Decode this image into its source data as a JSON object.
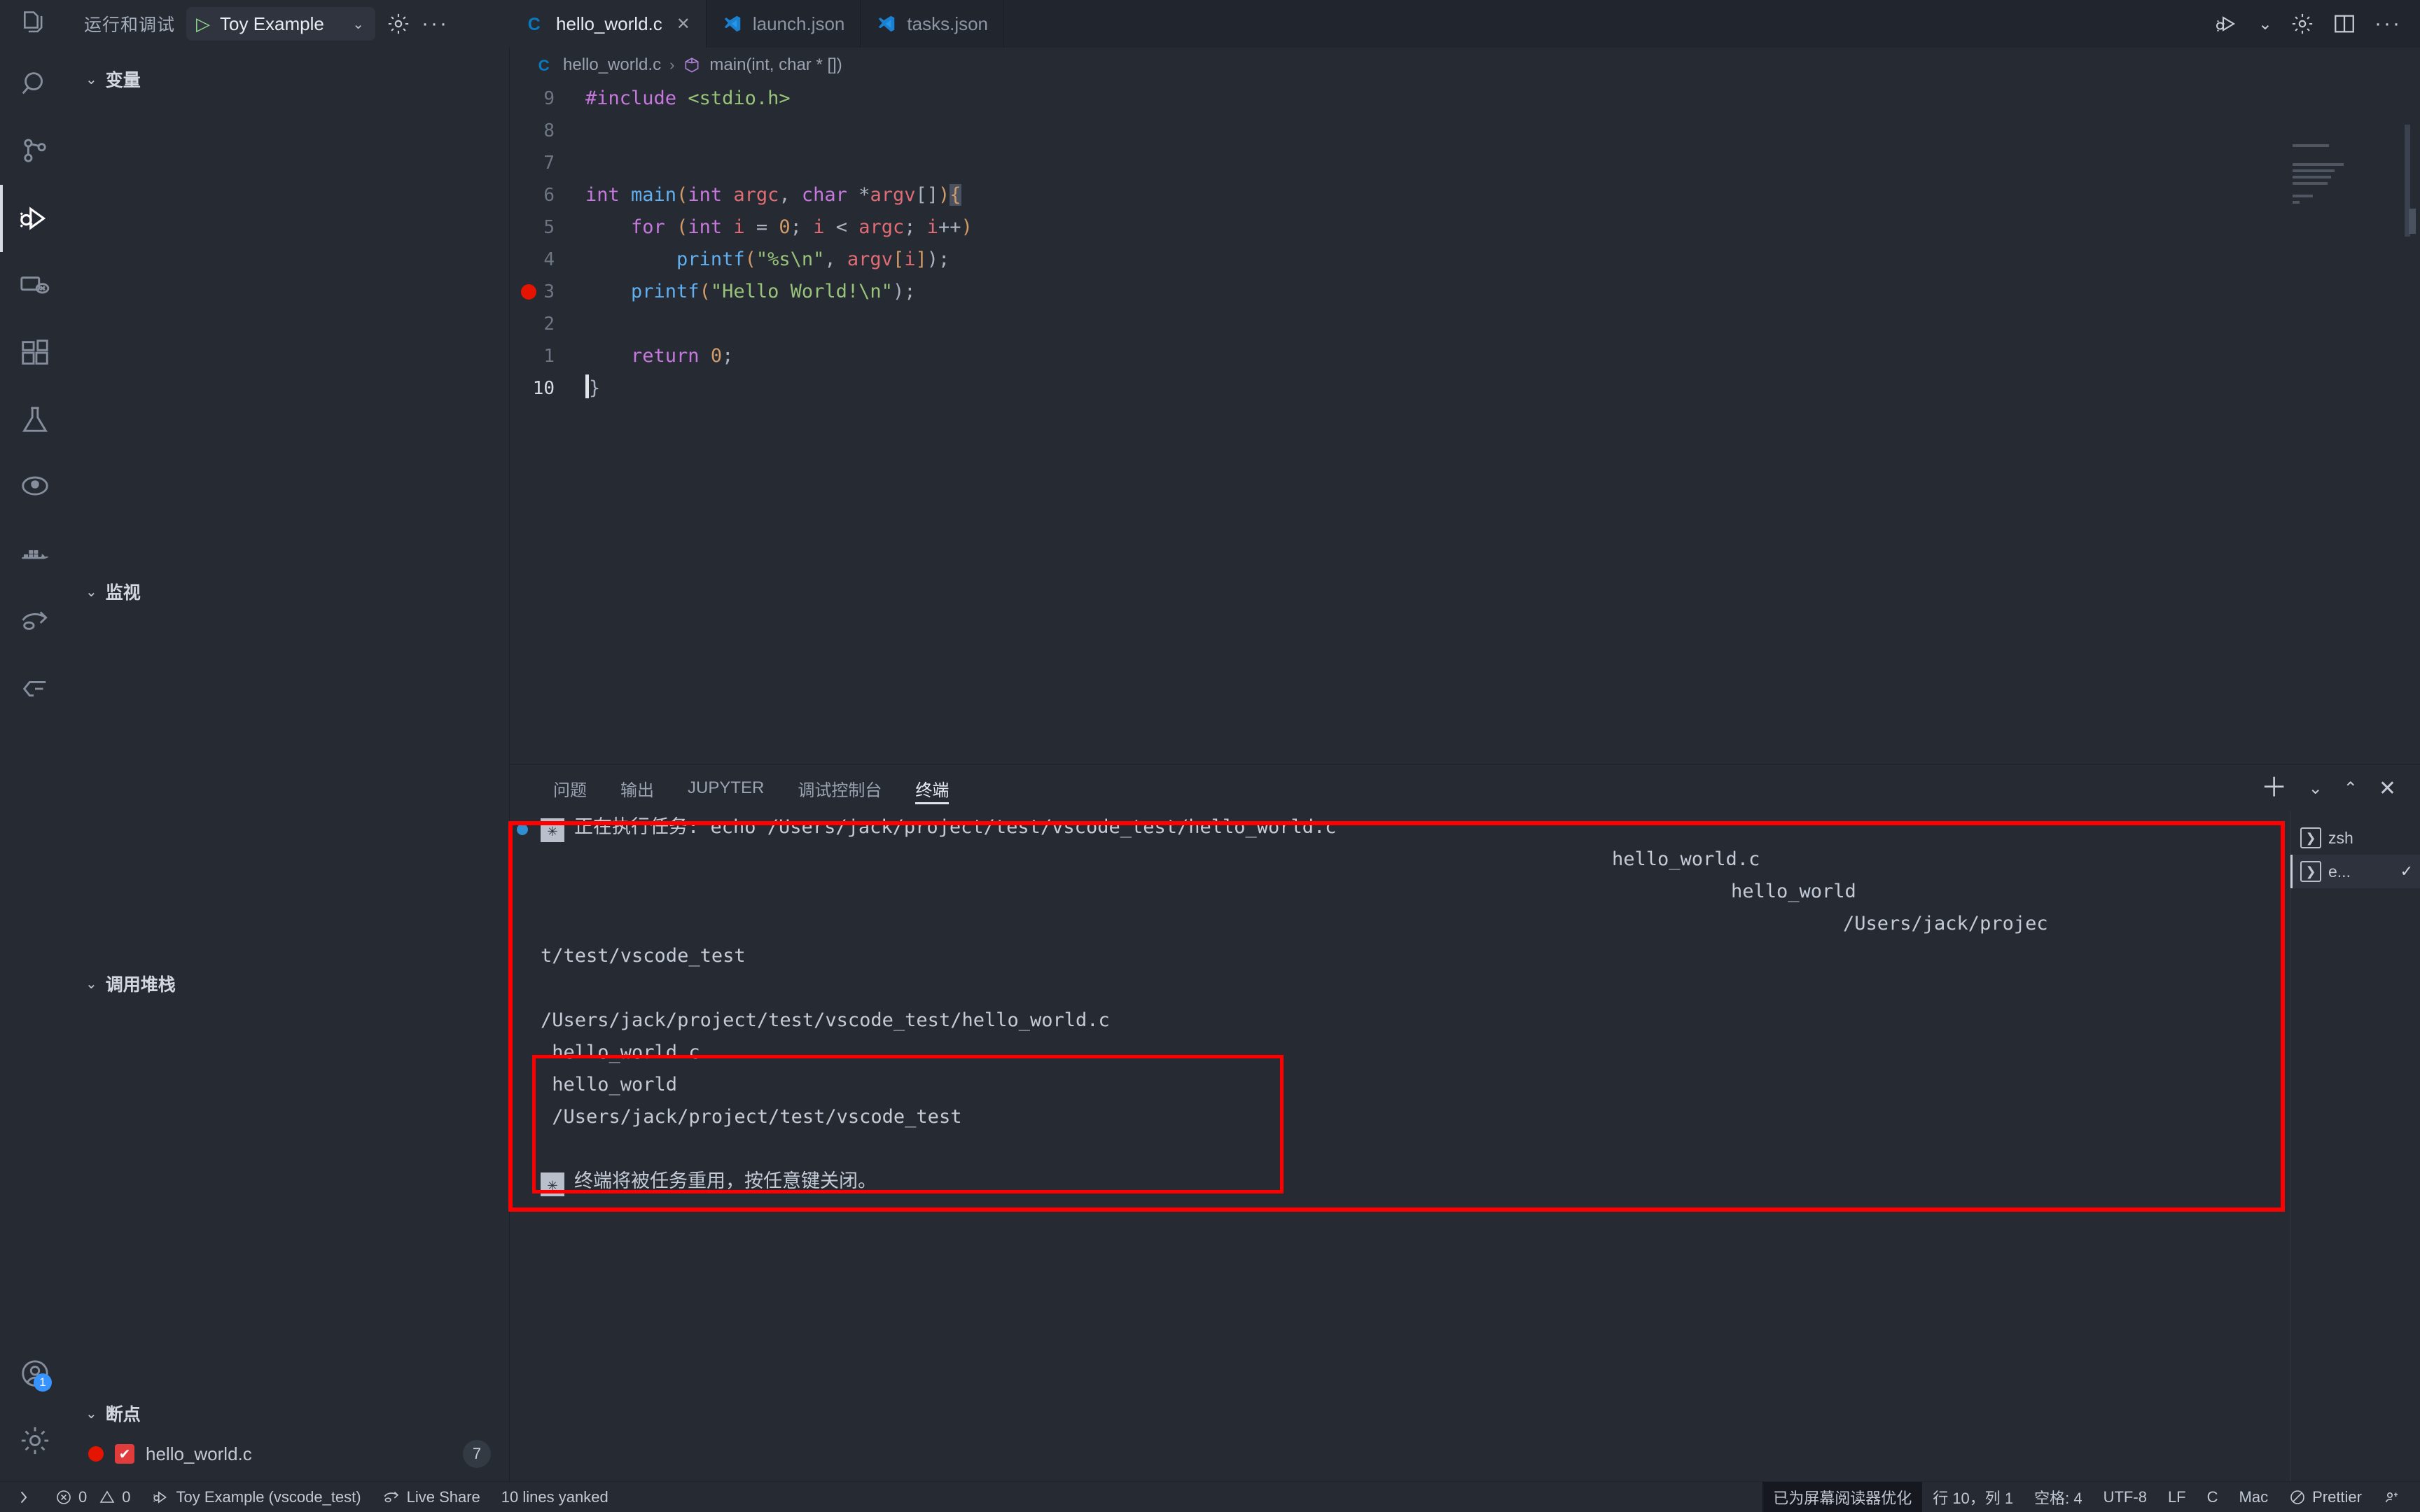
{
  "window": {
    "theme_bg": "#252a33",
    "accent": "#3794ff",
    "highlight_box_color": "#ff0000"
  },
  "debug_header": {
    "title": "运行和调试",
    "config_name": "Toy Example",
    "play_icon": "play-icon",
    "chevron_icon": "chevron-down-icon",
    "gear_icon": "gear-icon",
    "more_icon": "more-icon"
  },
  "activity_bar": {
    "items": [
      {
        "name": "explorer",
        "icon": "files-icon",
        "active": false
      },
      {
        "name": "search",
        "icon": "search-icon",
        "active": false
      },
      {
        "name": "source-control",
        "icon": "source-control-icon",
        "active": false
      },
      {
        "name": "run-and-debug",
        "icon": "debug-icon",
        "active": true
      },
      {
        "name": "remote-explorer",
        "icon": "remote-icon",
        "active": false
      },
      {
        "name": "extensions",
        "icon": "extensions-icon",
        "active": false
      },
      {
        "name": "testing",
        "icon": "beaker-icon",
        "active": false
      },
      {
        "name": "github",
        "icon": "github-icon",
        "active": false
      },
      {
        "name": "docker",
        "icon": "docker-icon",
        "active": false
      },
      {
        "name": "live-share",
        "icon": "live-share-icon",
        "active": false
      },
      {
        "name": "codestream",
        "icon": "codestream-icon",
        "active": false
      }
    ],
    "bottom": [
      {
        "name": "accounts",
        "icon": "account-icon",
        "badge": "1"
      },
      {
        "name": "manage",
        "icon": "gear-icon",
        "badge": ""
      }
    ]
  },
  "sidebar": {
    "sections": [
      {
        "label": "变量",
        "expanded": true
      },
      {
        "label": "监视",
        "expanded": true
      },
      {
        "label": "调用堆栈",
        "expanded": true
      },
      {
        "label": "断点",
        "expanded": true
      }
    ],
    "breakpoints": [
      {
        "file": "hello_world.c",
        "line": "7",
        "enabled": true
      }
    ]
  },
  "editor": {
    "tabs": [
      {
        "label": "hello_world.c",
        "icon": "c-file-icon",
        "active": true,
        "closable": true
      },
      {
        "label": "launch.json",
        "icon": "vscode-json-icon",
        "active": false,
        "closable": false
      },
      {
        "label": "tasks.json",
        "icon": "vscode-json-icon",
        "active": false,
        "closable": false
      }
    ],
    "actions": [
      {
        "name": "run-and-debug-editor",
        "icon": "debug-icon"
      },
      {
        "name": "run-dropdown",
        "icon": "chevron-down-icon"
      },
      {
        "name": "editor-settings",
        "icon": "gear-icon"
      },
      {
        "name": "split-editor",
        "icon": "split-editor-icon"
      },
      {
        "name": "editor-more",
        "icon": "more-icon"
      }
    ],
    "breadcrumb": {
      "file_icon": "c-file-icon",
      "file": "hello_world.c",
      "separator": "›",
      "symbol_icon": "symbol-method-icon",
      "symbol": "main(int, char * [])"
    },
    "lines": [
      {
        "num": "9",
        "breakpoint": false,
        "tokens": [
          {
            "t": "#include ",
            "c": "k-pre"
          },
          {
            "t": "<stdio.h>",
            "c": "k-inc"
          }
        ],
        "indent": 0
      },
      {
        "num": "8",
        "breakpoint": false,
        "tokens": [],
        "indent": 0
      },
      {
        "num": "7",
        "breakpoint": false,
        "tokens": [],
        "indent": 0
      },
      {
        "num": "6",
        "breakpoint": false,
        "tokens": [
          {
            "t": "int ",
            "c": "k-type"
          },
          {
            "t": "main",
            "c": "k-fn"
          },
          {
            "t": "(",
            "c": "k-punc"
          },
          {
            "t": "int ",
            "c": "k-type"
          },
          {
            "t": "argc",
            "c": "k-var"
          },
          {
            "t": ", ",
            "c": "k-plain"
          },
          {
            "t": "char ",
            "c": "k-type"
          },
          {
            "t": "*",
            "c": "k-plain"
          },
          {
            "t": "argv",
            "c": "k-var"
          },
          {
            "t": "[]",
            "c": "k-plain"
          },
          {
            "t": ")",
            "c": "k-punc"
          },
          {
            "t": "{",
            "c": "brace-hl k-punc"
          }
        ],
        "indent": 0
      },
      {
        "num": "5",
        "breakpoint": false,
        "tokens": [
          {
            "t": "    ",
            "c": "k-plain"
          },
          {
            "t": "for ",
            "c": "k-kw"
          },
          {
            "t": "(",
            "c": "k-punc"
          },
          {
            "t": "int ",
            "c": "k-type"
          },
          {
            "t": "i",
            "c": "k-var"
          },
          {
            "t": " = ",
            "c": "k-plain"
          },
          {
            "t": "0",
            "c": "k-num"
          },
          {
            "t": "; ",
            "c": "k-plain"
          },
          {
            "t": "i",
            "c": "k-var"
          },
          {
            "t": " < ",
            "c": "k-plain"
          },
          {
            "t": "argc",
            "c": "k-var"
          },
          {
            "t": "; ",
            "c": "k-plain"
          },
          {
            "t": "i",
            "c": "k-var"
          },
          {
            "t": "++",
            "c": "k-plain"
          },
          {
            "t": ")",
            "c": "k-punc"
          }
        ],
        "indent": 1
      },
      {
        "num": "4",
        "breakpoint": false,
        "tokens": [
          {
            "t": "        ",
            "c": "k-plain"
          },
          {
            "t": "printf",
            "c": "k-fn"
          },
          {
            "t": "(",
            "c": "k-punc"
          },
          {
            "t": "\"%s\\n\"",
            "c": "k-str"
          },
          {
            "t": ", ",
            "c": "k-plain"
          },
          {
            "t": "argv",
            "c": "k-var"
          },
          {
            "t": "[",
            "c": "k-punc"
          },
          {
            "t": "i",
            "c": "k-var"
          },
          {
            "t": "]",
            "c": "k-punc"
          },
          {
            "t": ");",
            "c": "k-plain"
          }
        ],
        "indent": 2
      },
      {
        "num": "3",
        "breakpoint": true,
        "tokens": [
          {
            "t": "    ",
            "c": "k-plain"
          },
          {
            "t": "printf",
            "c": "k-fn"
          },
          {
            "t": "(",
            "c": "k-punc"
          },
          {
            "t": "\"Hello World!\\n\"",
            "c": "k-str"
          },
          {
            "t": ");",
            "c": "k-plain"
          }
        ],
        "indent": 1
      },
      {
        "num": "2",
        "breakpoint": false,
        "tokens": [],
        "indent": 1
      },
      {
        "num": "1",
        "breakpoint": false,
        "tokens": [
          {
            "t": "    ",
            "c": "k-plain"
          },
          {
            "t": "return ",
            "c": "k-kw"
          },
          {
            "t": "0",
            "c": "k-num"
          },
          {
            "t": ";",
            "c": "k-plain"
          }
        ],
        "indent": 1
      },
      {
        "num": "10",
        "breakpoint": false,
        "tokens": [
          {
            "t": "}",
            "c": "k-plain"
          }
        ],
        "indent": 0,
        "current": true
      }
    ]
  },
  "panel": {
    "tabs": [
      {
        "label": "问题",
        "active": false
      },
      {
        "label": "输出",
        "active": false
      },
      {
        "label": "JUPYTER",
        "active": false
      },
      {
        "label": "调试控制台",
        "active": false
      },
      {
        "label": "终端",
        "active": true
      }
    ],
    "actions": [
      {
        "name": "new-terminal",
        "icon": "plus-icon"
      },
      {
        "name": "terminal-profile-dropdown",
        "icon": "chevron-down-icon"
      },
      {
        "name": "maximize-panel",
        "icon": "chevron-up-icon"
      },
      {
        "name": "close-panel",
        "icon": "close-icon"
      }
    ],
    "terminal": {
      "task_marker": "✳",
      "task_line": "正在执行任务: echo /Users/jack/project/test/vscode_test/hello_world.c",
      "wrapped_out": [
        "hello_world.c",
        "hello_world",
        "/Users/jack/projec",
        "t/test/vscode_test"
      ],
      "output_block": [
        "/Users/jack/project/test/vscode_test/hello_world.c",
        " hello_world.c",
        " hello_world",
        " /Users/jack/project/test/vscode_test"
      ],
      "footer_marker": "✳",
      "footer_line": "终端将被任务重用，按任意键关闭。"
    },
    "terminal_tabs": [
      {
        "label": "zsh",
        "icon": "terminal-icon",
        "active": false,
        "check": ""
      },
      {
        "label": "e...",
        "icon": "terminal-icon",
        "active": true,
        "check": "✓"
      }
    ]
  },
  "status_bar": {
    "left": [
      {
        "name": "remote-indicator",
        "icon": "remote-icon",
        "text": ""
      },
      {
        "name": "problems",
        "icon": "error-icon",
        "text": "0",
        "icon2": "warning-icon",
        "text2": "0"
      },
      {
        "name": "debug-config",
        "icon": "debug-icon",
        "text": "Toy Example (vscode_test)"
      },
      {
        "name": "live-share",
        "icon": "live-share-icon",
        "text": "Live Share"
      },
      {
        "name": "editor-message",
        "icon": "",
        "text": "10 lines yanked"
      }
    ],
    "right": [
      {
        "name": "screen-reader-optimized",
        "text": "已为屏幕阅读器优化",
        "highlight": true
      },
      {
        "name": "cursor-position",
        "text": "行 10，列 1"
      },
      {
        "name": "indentation",
        "text": "空格: 4"
      },
      {
        "name": "encoding",
        "text": "UTF-8"
      },
      {
        "name": "eol",
        "text": "LF"
      },
      {
        "name": "language-mode",
        "text": "C"
      },
      {
        "name": "platform",
        "text": "Mac"
      },
      {
        "name": "prettier",
        "icon": "prettier-icon",
        "text": "Prettier"
      },
      {
        "name": "feedback",
        "icon": "bell-icon",
        "text": ""
      }
    ]
  }
}
